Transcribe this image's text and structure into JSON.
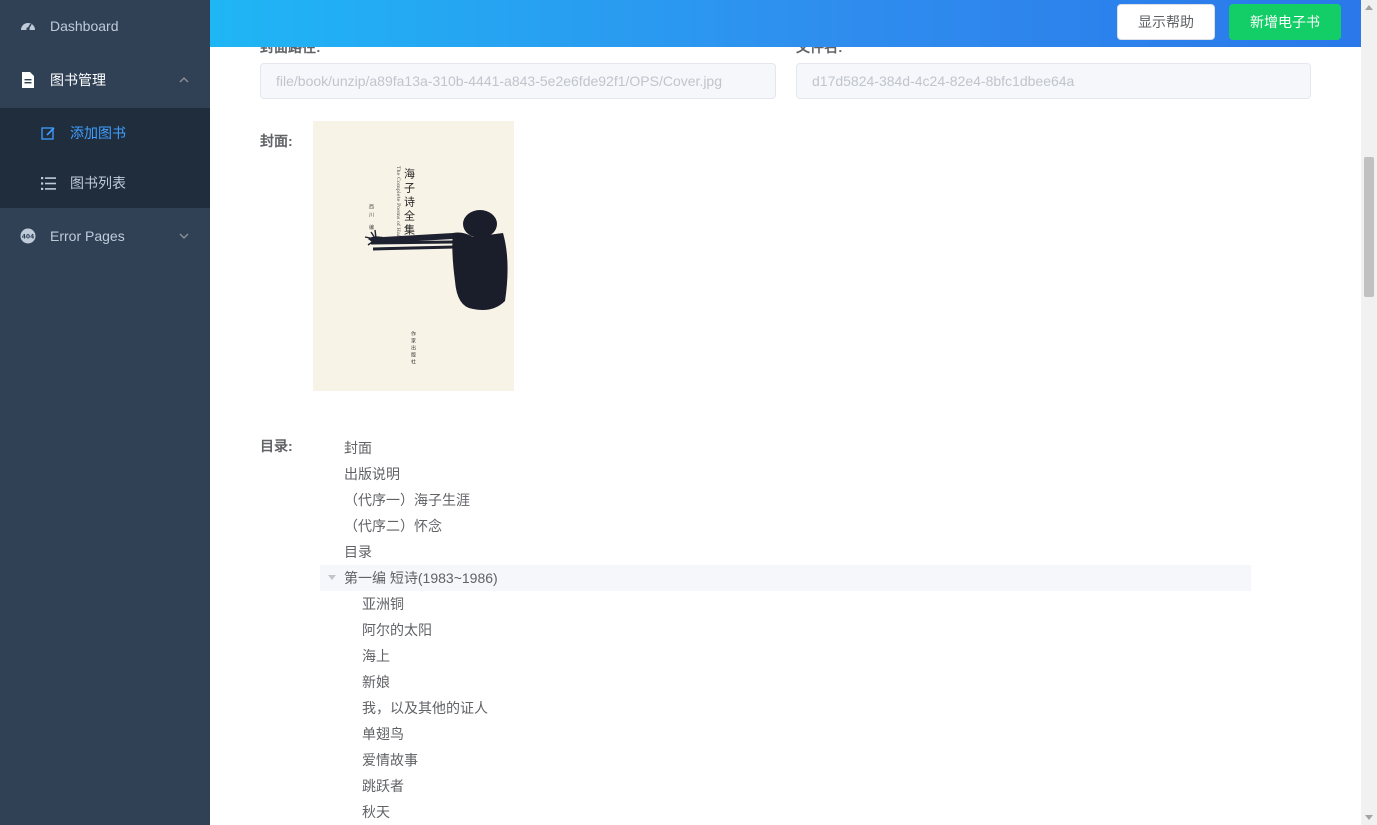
{
  "sidebar": {
    "dashboard": {
      "label": "Dashboard",
      "icon": "dashboard-icon"
    },
    "book_group": {
      "label": "图书管理",
      "icon": "document-icon"
    },
    "sub_items": [
      {
        "label": "添加图书",
        "icon": "edit-icon",
        "active": true
      },
      {
        "label": "图书列表",
        "icon": "list-icon",
        "active": false
      }
    ],
    "error_pages": {
      "label": "Error Pages",
      "icon": "404-icon"
    },
    "colors": {
      "bg": "#304156",
      "submenu_bg": "#1f2d3d",
      "active": "#409eff"
    }
  },
  "header": {
    "help_button": "显示帮助",
    "new_button": "新增电子书",
    "colors": {
      "gradient_start": "#1fb6f5",
      "gradient_end": "#2a78ea",
      "new_button": "#13ce66"
    }
  },
  "form": {
    "cover_path_label": "封面路径:",
    "cover_path_value": "file/book/unzip/a89fa13a-310b-4441-a843-5e2e6fde92f1/OPS/Cover.jpg",
    "file_name_label": "文件名:",
    "file_name_value": "d17d5824-384d-4c24-82e4-8bfc1dbee64a",
    "cover_label": "封面:",
    "cover_image": {
      "title": "海子诗全集",
      "subtitle": "The Complete Poems of Haizi",
      "editor": "西川 编",
      "publisher": "作家出版社"
    },
    "toc_label": "目录:"
  },
  "toc": [
    {
      "label": "封面",
      "level": 1
    },
    {
      "label": "出版说明",
      "level": 1
    },
    {
      "label": "（代序一）海子生涯",
      "level": 1
    },
    {
      "label": "（代序二）怀念",
      "level": 1
    },
    {
      "label": "目录",
      "level": 1
    },
    {
      "label": "第一编 短诗(1983~1986)",
      "level": 1,
      "expanded": true,
      "highlighted": true
    },
    {
      "label": "亚洲铜",
      "level": 2
    },
    {
      "label": "阿尔的太阳",
      "level": 2
    },
    {
      "label": "海上",
      "level": 2
    },
    {
      "label": "新娘",
      "level": 2
    },
    {
      "label": "我，以及其他的证人",
      "level": 2
    },
    {
      "label": "单翅鸟",
      "level": 2
    },
    {
      "label": "爱情故事",
      "level": 2
    },
    {
      "label": "跳跃者",
      "level": 2
    },
    {
      "label": "秋天",
      "level": 2
    }
  ]
}
